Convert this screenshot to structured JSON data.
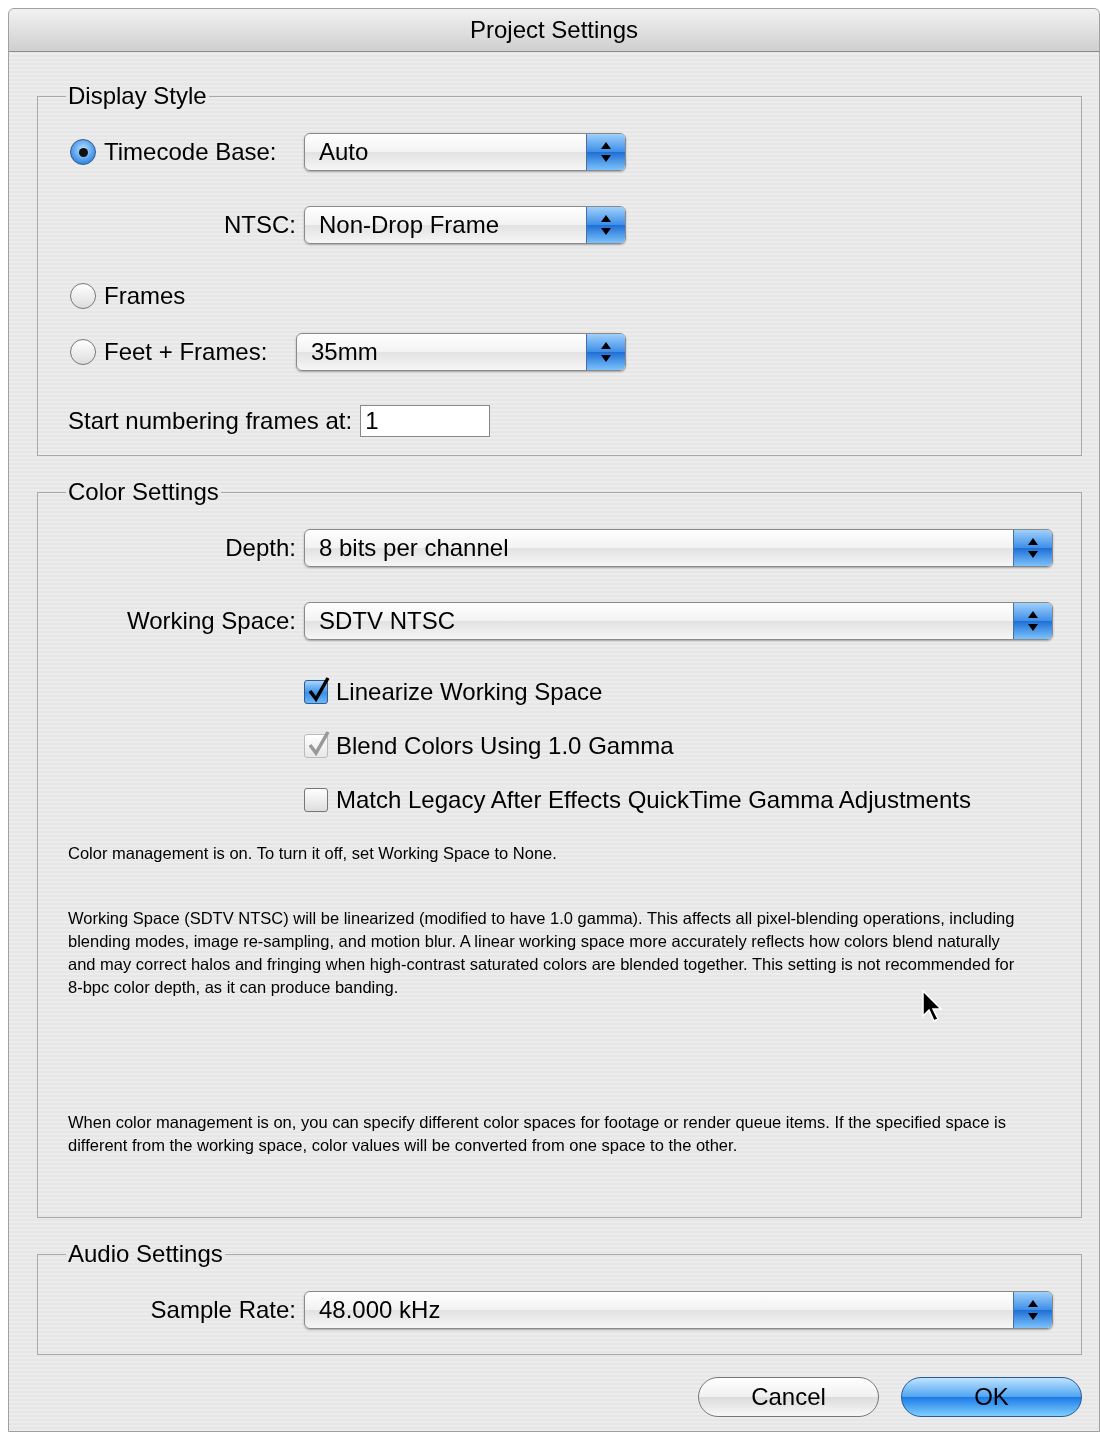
{
  "window": {
    "title": "Project Settings"
  },
  "display_style": {
    "title": "Display Style",
    "timecode_base": {
      "label": "Timecode Base:",
      "selected": true,
      "value": "Auto"
    },
    "ntsc": {
      "label": "NTSC:",
      "value": "Non-Drop Frame"
    },
    "frames": {
      "label": "Frames",
      "selected": false
    },
    "feet_frames": {
      "label": "Feet + Frames:",
      "selected": false,
      "value": "35mm"
    },
    "start_numbering": {
      "label": "Start numbering frames at:",
      "value": "1"
    }
  },
  "color_settings": {
    "title": "Color Settings",
    "depth": {
      "label": "Depth:",
      "value": "8 bits per channel"
    },
    "working_space": {
      "label": "Working Space:",
      "value": "SDTV NTSC"
    },
    "checkboxes": [
      {
        "label": "Linearize Working Space",
        "checked": true,
        "disabled": false
      },
      {
        "label": "Blend Colors Using 1.0 Gamma",
        "checked": true,
        "disabled": true
      },
      {
        "label": "Match Legacy After Effects QuickTime Gamma Adjustments",
        "checked": false,
        "disabled": false
      }
    ],
    "notes": [
      "Color management is on. To turn it off, set Working Space to None.",
      "Working Space (SDTV NTSC) will be linearized (modified to have 1.0 gamma). This affects all pixel-blending operations, including blending modes, image re-sampling, and motion blur. A linear working space more accurately reflects how colors blend naturally and may correct halos and fringing when high-contrast saturated colors are blended together. This setting is not recommended for 8-bpc color depth, as it can produce banding.",
      "When color management is on, you can specify different color spaces for footage or render queue items. If the specified space is different from the working space, color values will be converted from one space to the other."
    ]
  },
  "audio_settings": {
    "title": "Audio Settings",
    "sample_rate": {
      "label": "Sample Rate:",
      "value": "48.000 kHz"
    }
  },
  "buttons": [
    {
      "label": "Cancel",
      "default": false
    },
    {
      "label": "OK",
      "default": true
    }
  ]
}
